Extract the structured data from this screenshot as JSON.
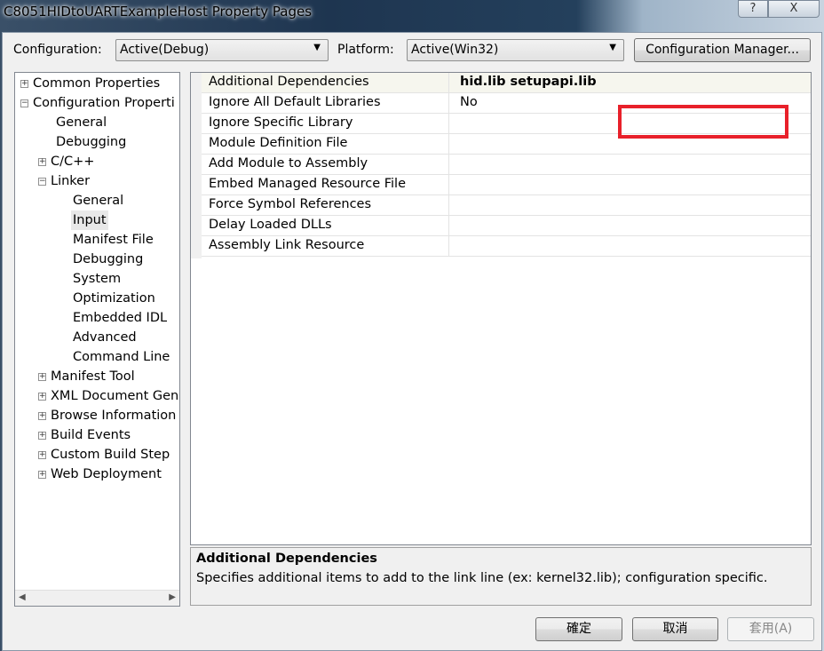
{
  "window": {
    "title": "C8051HIDtoUARTExampleHost Property Pages",
    "help_label": "?",
    "close_label": "X"
  },
  "toolbar": {
    "configuration_label": "Configuration:",
    "configuration_value": "Active(Debug)",
    "platform_label": "Platform:",
    "platform_value": "Active(Win32)",
    "config_manager_label": "Configuration Manager..."
  },
  "tree": [
    {
      "label": "Common Properties",
      "level": 0,
      "expander": "+"
    },
    {
      "label": "Configuration Properti",
      "level": 0,
      "expander": "-"
    },
    {
      "label": "General",
      "level": 1
    },
    {
      "label": "Debugging",
      "level": 1
    },
    {
      "label": "C/C++",
      "level": 1,
      "expander": "+"
    },
    {
      "label": "Linker",
      "level": 1,
      "expander": "-"
    },
    {
      "label": "General",
      "level": 2
    },
    {
      "label": "Input",
      "level": 2,
      "selected": true
    },
    {
      "label": "Manifest File",
      "level": 2
    },
    {
      "label": "Debugging",
      "level": 2
    },
    {
      "label": "System",
      "level": 2
    },
    {
      "label": "Optimization",
      "level": 2
    },
    {
      "label": "Embedded IDL",
      "level": 2
    },
    {
      "label": "Advanced",
      "level": 2
    },
    {
      "label": "Command Line",
      "level": 2
    },
    {
      "label": "Manifest Tool",
      "level": 1,
      "expander": "+"
    },
    {
      "label": "XML Document Gen",
      "level": 1,
      "expander": "+"
    },
    {
      "label": "Browse Information",
      "level": 1,
      "expander": "+"
    },
    {
      "label": "Build Events",
      "level": 1,
      "expander": "+"
    },
    {
      "label": "Custom Build Step",
      "level": 1,
      "expander": "+"
    },
    {
      "label": "Web Deployment",
      "level": 1,
      "expander": "+"
    }
  ],
  "properties": [
    {
      "name": "Additional Dependencies",
      "value": "hid.lib setupapi.lib",
      "bold": true,
      "selected": true
    },
    {
      "name": "Ignore All Default Libraries",
      "value": "No"
    },
    {
      "name": "Ignore Specific Library",
      "value": ""
    },
    {
      "name": "Module Definition File",
      "value": ""
    },
    {
      "name": "Add Module to Assembly",
      "value": ""
    },
    {
      "name": "Embed Managed Resource File",
      "value": ""
    },
    {
      "name": "Force Symbol References",
      "value": ""
    },
    {
      "name": "Delay Loaded DLLs",
      "value": ""
    },
    {
      "name": "Assembly Link Resource",
      "value": ""
    }
  ],
  "description": {
    "title": "Additional Dependencies",
    "text": "Specifies additional items to add to the link line (ex: kernel32.lib); configuration specific."
  },
  "buttons": {
    "ok": "確定",
    "cancel": "取消",
    "apply": "套用(A)"
  },
  "colors": {
    "highlight_box": "#e8202a"
  }
}
